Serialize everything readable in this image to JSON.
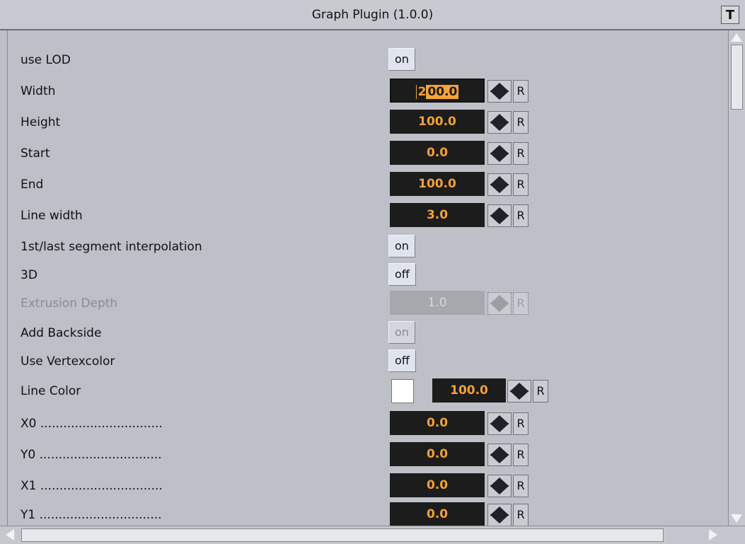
{
  "window": {
    "title": "Graph Plugin (1.0.0)",
    "corner_icon": "T"
  },
  "rows": [
    {
      "label": "use LOD",
      "type": "toggle",
      "value": "on"
    },
    {
      "label": "Width",
      "type": "number",
      "value_selected": "00.0",
      "value_prefix": "2",
      "editing": true,
      "reset": "R"
    },
    {
      "label": "Height",
      "type": "number",
      "value": "100.0",
      "reset": "R"
    },
    {
      "label": "Start",
      "type": "number",
      "value": "0.0",
      "reset": "R"
    },
    {
      "label": "End",
      "type": "number",
      "value": "100.0",
      "reset": "R"
    },
    {
      "label": "Line width",
      "type": "number",
      "value": "3.0",
      "reset": "R"
    },
    {
      "label": "1st/last segment interpolation",
      "type": "toggle",
      "value": "on"
    },
    {
      "label": "3D",
      "type": "toggle",
      "value": "off"
    },
    {
      "label": "Extrusion Depth",
      "type": "number",
      "value": "1.0",
      "reset": "R",
      "disabled": true
    },
    {
      "label": "Add Backside",
      "type": "toggle",
      "value": "on",
      "disabled": true
    },
    {
      "label": "Use Vertexcolor",
      "type": "toggle",
      "value": "off"
    },
    {
      "label": "Line Color",
      "type": "color",
      "swatch_color": "#ffffff",
      "value": "100.0",
      "reset": "R"
    },
    {
      "label": "X0 ................................",
      "type": "number",
      "value": "0.0",
      "reset": "R"
    },
    {
      "label": "Y0 ................................",
      "type": "number",
      "value": "0.0",
      "reset": "R"
    },
    {
      "label": "X1 ................................",
      "type": "number",
      "value": "0.0",
      "reset": "R"
    },
    {
      "label": "Y1 ................................",
      "type": "number",
      "value": "0.0",
      "reset": "R"
    }
  ],
  "colors": {
    "panel_bg": "#bdc0c7",
    "field_bg": "#1c1c1c",
    "field_text": "#f1a13a",
    "toggle_bg": "#e0e4ee"
  }
}
